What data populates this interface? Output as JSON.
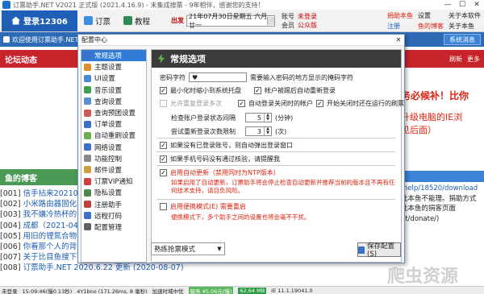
{
  "window": {
    "title": "订票助手.NET V2021 正式版 (2021.4.16.9) - 未集成搜票 - 9年相伴，感谢您的支持！",
    "controls": [
      "—",
      "☐",
      "✕"
    ]
  },
  "toolbar": {
    "login_label": "登录12306",
    "pick_label": "订票",
    "tutorial_label": "教程",
    "date_label": "出发",
    "date_value": "21年07月30日星期五 六月廿一",
    "account_label": "账号",
    "account_value": "未登录",
    "member_label": "会员",
    "member_value": "公众版",
    "links": [
      "捐助本鱼",
      "设置",
      "关于本软件",
      "注册",
      "鱼的博客",
      "关于本鱼"
    ]
  },
  "subbar": {
    "welcome": "欢迎使用订票助手.NET",
    "sys_button": "系统消息"
  },
  "left": {
    "forum_title": "论坛动态",
    "fish_title": "鱼的博客",
    "posts": [
      {
        "no": "[001]",
        "title": "信手拈来20210..."
      },
      {
        "no": "[002]",
        "title": "小米路由器固化..."
      },
      {
        "no": "[003]",
        "title": "我不嫌冷热杯的..."
      },
      {
        "no": "[004]",
        "title": "成都（2021-04-1..."
      },
      {
        "no": "[005]",
        "title": "用旧的锂氮合物..."
      },
      {
        "no": "[006]",
        "title": "你看那个人的背影，他在..."
      },
      {
        "no": "[007]",
        "title": "关于比目鱼搜下列内容的说明 (2020-08-08)"
      },
      {
        "no": "[008]",
        "title": "订票助手.NET 2020.6.22 更新 (2020-08-07)"
      }
    ]
  },
  "right": {
    "refresh": "刷新",
    "more": "更多",
    "ad_line1": "务必候补！比你",
    "ad_line2": "升级电脑的IE浏",
    "ad_line3": "见后面）",
    "links": [
      "/help/18520/download",
      "此本鱼不能理。捐助方式",
      "此本鱼的捐客页面",
      "et/donate/)"
    ]
  },
  "dialog": {
    "title": "配置中心",
    "close": "✕",
    "nav": [
      {
        "label": "常规选项",
        "icon": "gear-icon",
        "color": "#3a70c8",
        "selected": true
      },
      {
        "label": "主题设置",
        "icon": "palette-icon",
        "color": "#e08b2c"
      },
      {
        "label": "UI设置",
        "icon": "ui-icon",
        "color": "#4a88d8"
      },
      {
        "label": "音乐设置",
        "icon": "music-icon",
        "color": "#3aa04a"
      },
      {
        "label": "查询设置",
        "icon": "search-icon",
        "color": "#5a8fd0"
      },
      {
        "label": "查询预团设置",
        "icon": "list-icon",
        "color": "#d05a5a"
      },
      {
        "label": "订单设置",
        "icon": "order-icon",
        "color": "#3a70c8"
      },
      {
        "label": "自动重刷设置",
        "icon": "refresh-icon",
        "color": "#6ab04c"
      },
      {
        "label": "网络设置",
        "icon": "network-icon",
        "color": "#3a70c8"
      },
      {
        "label": "功能控制",
        "icon": "control-icon",
        "color": "#888888"
      },
      {
        "label": "邮件设置",
        "icon": "mail-icon",
        "color": "#d0a040"
      },
      {
        "label": "订票VIP通知",
        "icon": "vip-icon",
        "color": "#d04040"
      },
      {
        "label": "隐私设置",
        "icon": "lock-icon",
        "color": "#4a8a4a"
      },
      {
        "label": "注册助手",
        "icon": "user-icon",
        "color": "#c04040"
      },
      {
        "label": "远程打码",
        "icon": "remote-icon",
        "color": "#3a70c8"
      },
      {
        "label": "配置管理",
        "icon": "config-icon",
        "color": "#606060"
      }
    ],
    "panel_title": "常规选项",
    "password_label": "密码字符",
    "password_value": "♥",
    "password_hint": "需要输入密码的地方显示的掩码字符",
    "opt_min_tray": "最小化时缩小到系统托盘",
    "opt_auto_login": "帐户被踢后自动重新登录",
    "opt_multi": "允许重复登录多次",
    "opt_auto_close": "自动登录关闭时的帐户",
    "opt_start_check": "开始关闭时还在运行的刷票",
    "interval_label": "检查账户登录状态间隔",
    "interval_value": "5",
    "interval_unit": "(分钟)",
    "relogin_label": "尝试重新登录次数限制",
    "relogin_value": "3",
    "relogin_unit": "(次)",
    "opt_no_login": "如果没有已登录账号，则自动弹出登录窗口",
    "opt_phone_verify": "如果手机号码没有通过核验，请提醒我",
    "opt_auto_update": "启用自动更新（禁用同时为NTP版本）",
    "update_note": "如果启用了自动更新，订票助手将会停止检查自动更新并推荐当前的版本且不再有任何技术支持，请自负风险。",
    "opt_easy_mode": "启用便携模式(E)  需要重启",
    "easy_note": "便携模式下，多个助手之间的设置也将会毫不干扰。",
    "mode_select": "熟练抢票模式",
    "save_label": "保存配置(S)"
  },
  "status": {
    "items": [
      "未登录",
      "15:09:46(慢0.13秒)",
      "4Y1bno (171.26ms, 8 毫秒)",
      "加速时域中忧",
      "服务 ¥5.06元(慢)",
      "62.64 MB",
      "IE 11.1.19041.0"
    ]
  },
  "watermark": "爬虫资源"
}
